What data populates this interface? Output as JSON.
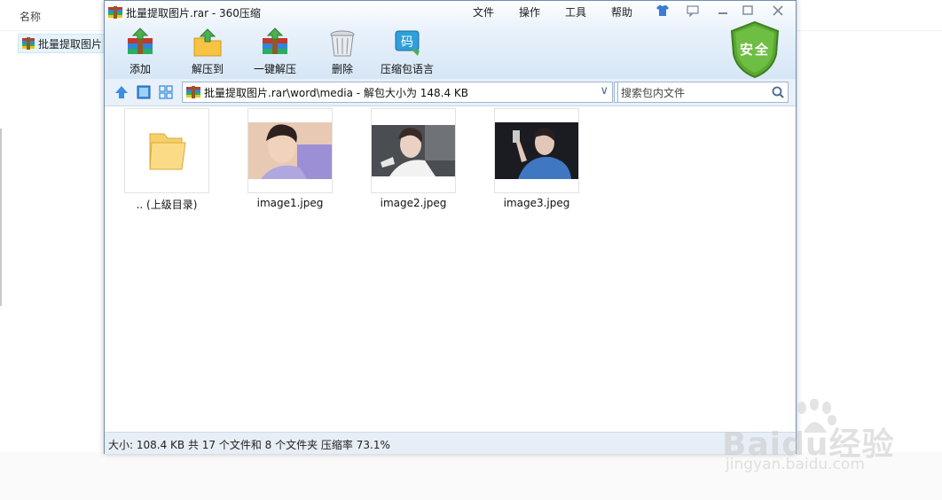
{
  "background_explorer": {
    "column_header": "名称",
    "file_label": "批量提取图片"
  },
  "window": {
    "title": "批量提取图片.rar - 360压缩",
    "menu": [
      "文件",
      "操作",
      "工具",
      "帮助"
    ],
    "toolbar": [
      {
        "label": "添加",
        "icon": "add-archive-icon"
      },
      {
        "label": "解压到",
        "icon": "extract-to-icon"
      },
      {
        "label": "一键解压",
        "icon": "one-click-extract-icon"
      },
      {
        "label": "删除",
        "icon": "delete-icon"
      },
      {
        "label": "压缩包语言",
        "icon": "archive-language-icon",
        "icon_text": "码"
      }
    ],
    "security_badge": "安全",
    "path": "批量提取图片.rar\\word\\media - 解包大小为 148.4 KB",
    "search_placeholder": "搜索包内文件",
    "items": [
      {
        "label": ".. (上级目录)",
        "type": "folder"
      },
      {
        "label": "image1.jpeg",
        "type": "image"
      },
      {
        "label": "image2.jpeg",
        "type": "image"
      },
      {
        "label": "image3.jpeg",
        "type": "image"
      }
    ],
    "status": "大小: 108.4 KB 共 17 个文件和 8 个文件夹 压缩率 73.1%"
  },
  "watermark": {
    "brand": "Baidu经验",
    "url": "jingyan.baidu.com"
  },
  "colors": {
    "title_gradient_end": "#d6e6f6",
    "shield_green": "#5aa832",
    "status_bar": "#e7eef6"
  }
}
